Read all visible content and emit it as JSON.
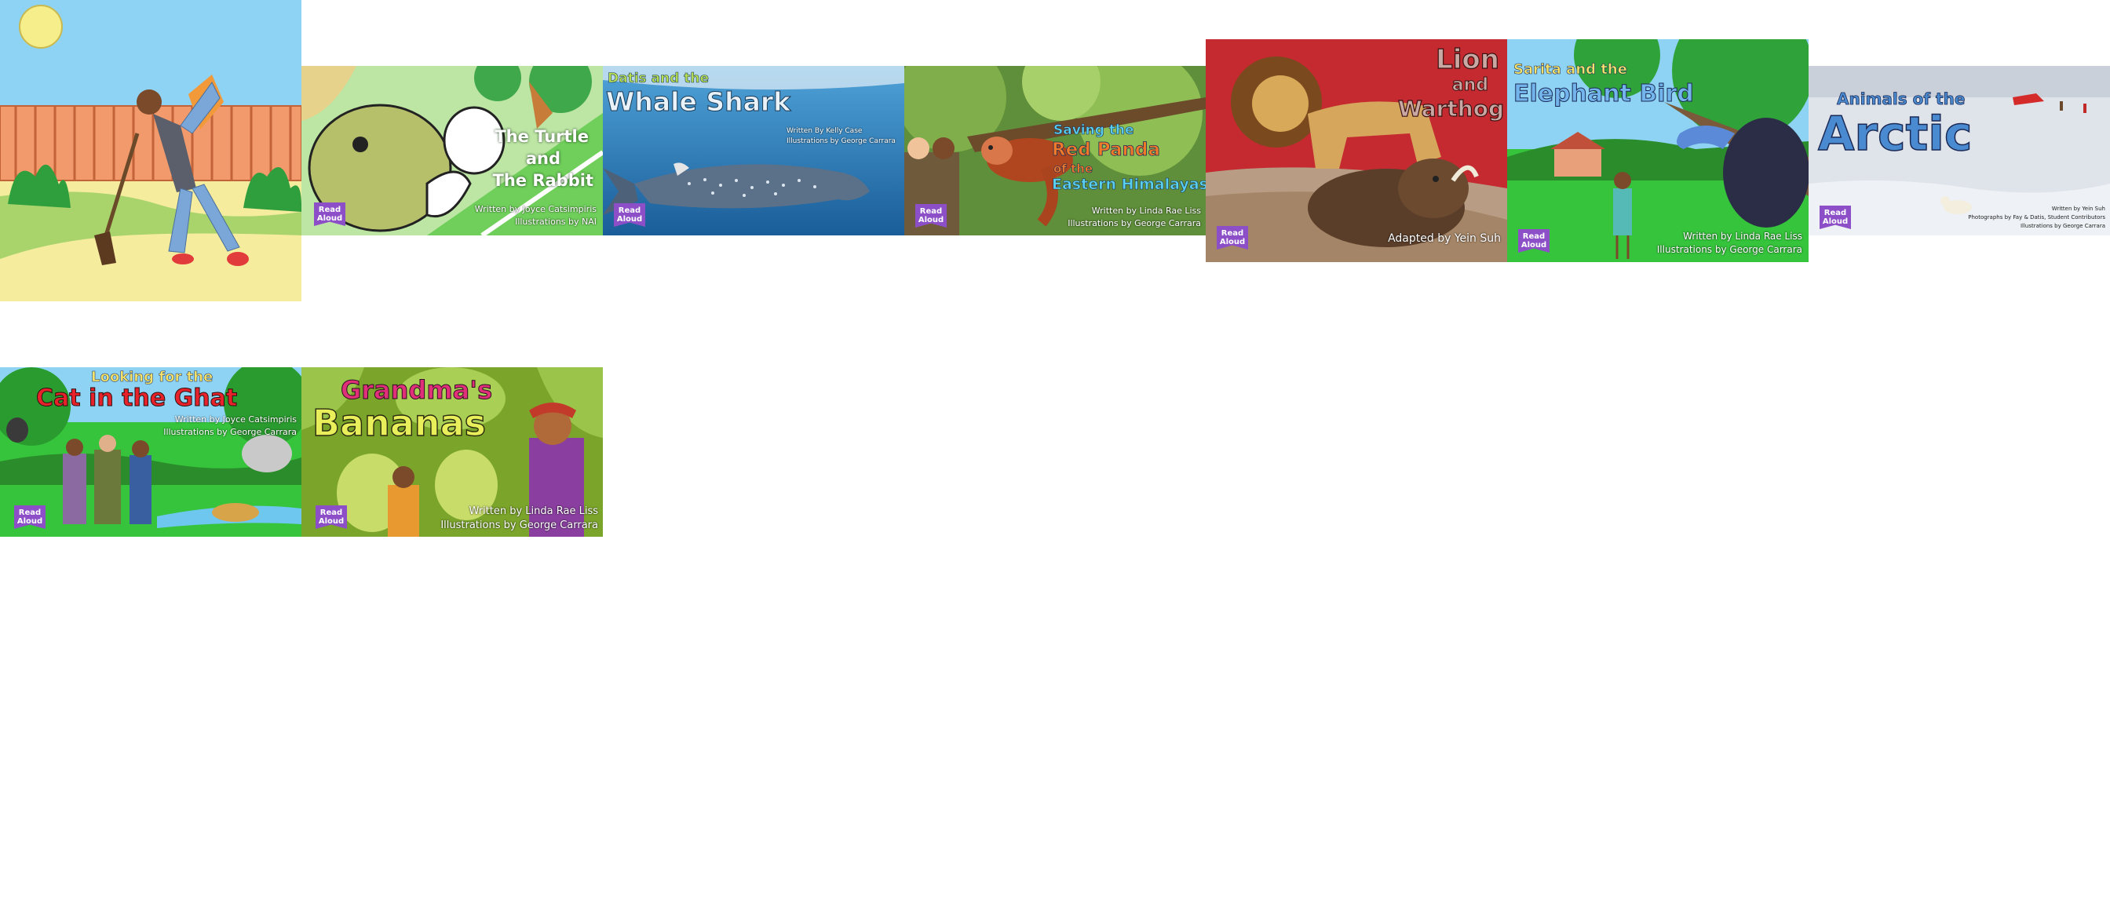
{
  "badge": {
    "line1": "Read",
    "line2": "Aloud"
  },
  "books": [
    {
      "id": "hoe",
      "title_lines": [],
      "credits": []
    },
    {
      "id": "turtle",
      "title_lines": [
        "The Turtle",
        "and",
        "The Rabbit"
      ],
      "credits": [
        "Written by Joyce Catsimpiris",
        "Illustrations by NAI"
      ]
    },
    {
      "id": "whale",
      "title_lines": [
        "Datis and the",
        "Whale Shark"
      ],
      "credits": [
        "Written By Kelly Case",
        "Illustrations by George Carrara"
      ]
    },
    {
      "id": "panda",
      "title_lines": [
        "Saving the",
        "Red Panda",
        "of the",
        "Eastern Himalayas"
      ],
      "credits": [
        "Written by Linda Rae Liss",
        "Illustrations by George Carrara"
      ]
    },
    {
      "id": "lion",
      "title_lines": [
        "Lion",
        "and",
        "Warthog"
      ],
      "credits": [
        "Adapted by Yein Suh"
      ]
    },
    {
      "id": "elephant",
      "title_lines": [
        "Sarita and the",
        "Elephant Bird"
      ],
      "credits": [
        "Written by Linda Rae Liss",
        "Illustrations by George Carrara"
      ]
    },
    {
      "id": "arctic",
      "title_lines": [
        "Animals of the",
        "Arctic"
      ],
      "credits": [
        "Written by Yein Suh",
        "Photographs by Fay & Datis, Student Contributors",
        "Illustrations by George Carrara"
      ]
    },
    {
      "id": "cat",
      "title_lines": [
        "Looking for the",
        "Cat in the Ghat"
      ],
      "credits": [
        "Written by Joyce Catsimpiris",
        "Illustrations by George Carrara"
      ]
    },
    {
      "id": "bananas",
      "title_lines": [
        "Grandma's",
        "Bananas"
      ],
      "credits": [
        "Written by Linda Rae Liss",
        "Illustrations by George Carrara"
      ]
    }
  ],
  "colors": {
    "badge": "#8d4fc8",
    "sky": "#8fd3f4",
    "grass": "#35c43b",
    "ocean": "#1f6fb3",
    "red_bg": "#c42a2f",
    "snow": "#dfe3ea"
  }
}
